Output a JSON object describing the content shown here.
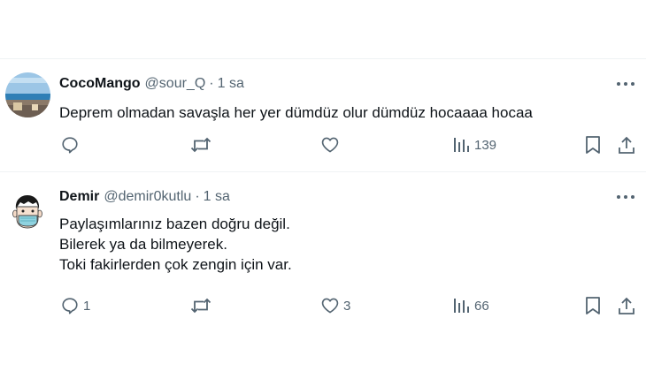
{
  "tweets": [
    {
      "name": "CocoMango",
      "handle": "@sour_Q",
      "separator": "·",
      "time": "1 sa",
      "lines": [
        "Deprem olmadan savaşla her yer dümdüz olur dümdüz hocaaaa hocaa"
      ],
      "counts": {
        "reply": "",
        "retweet": "",
        "like": "",
        "views": "139"
      }
    },
    {
      "name": "Demir",
      "handle": "@demir0kutlu",
      "separator": "·",
      "time": "1 sa",
      "lines": [
        "Paylaşımlarınız bazen doğru değil.",
        "Bilerek ya da bilmeyerek.",
        "Toki fakirlerden çok zengin için var."
      ],
      "counts": {
        "reply": "1",
        "retweet": "",
        "like": "3",
        "views": "66"
      }
    }
  ],
  "icons": {
    "reply": "speech-bubble-icon",
    "retweet": "retweet-arrows-icon",
    "like": "heart-outline-icon",
    "views": "bar-chart-icon",
    "bookmark": "bookmark-icon",
    "share": "share-upload-icon",
    "more": "three-dots-icon"
  },
  "colors": {
    "text": "#0f1419",
    "secondary": "#536471",
    "divider": "#eff3f4"
  }
}
